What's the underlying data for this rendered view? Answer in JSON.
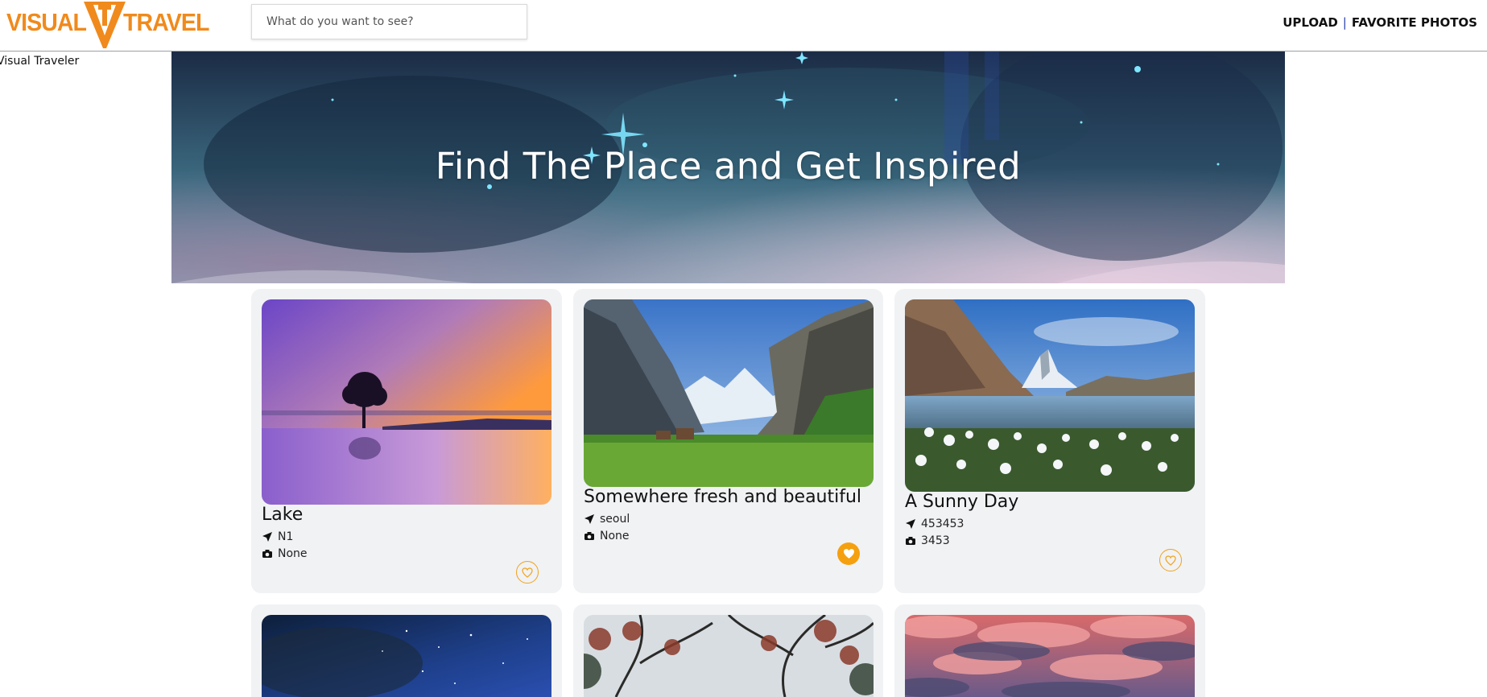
{
  "header": {
    "logo_left": "VISUAL",
    "logo_right": "TRAVEL",
    "search_placeholder": "What do you want to see?",
    "nav": {
      "upload": "UPLOAD",
      "separator": "|",
      "favorites": "FAVORITE PHOTOS"
    },
    "alt_text": "Visual Traveler"
  },
  "hero": {
    "title": "Find The Place and Get Inspired"
  },
  "colors": {
    "accent": "#f5a00f",
    "logo": "#f08a1c",
    "card_bg": "#f1f2f4"
  },
  "cards": [
    {
      "title": "Lake",
      "location": "N1",
      "camera": "None",
      "favorite": false,
      "image": "purple-lake-sunset"
    },
    {
      "title": "Somewhere fresh and beautiful",
      "location": "seoul",
      "camera": "None",
      "favorite": true,
      "image": "green-valley-cliffs"
    },
    {
      "title": "A Sunny Day",
      "location": "453453",
      "camera": "3453",
      "favorite": false,
      "image": "mountain-lake-flowers"
    },
    {
      "image": "starry-night-sky"
    },
    {
      "image": "autumn-trees"
    },
    {
      "image": "pink-clouds-sunset"
    }
  ]
}
